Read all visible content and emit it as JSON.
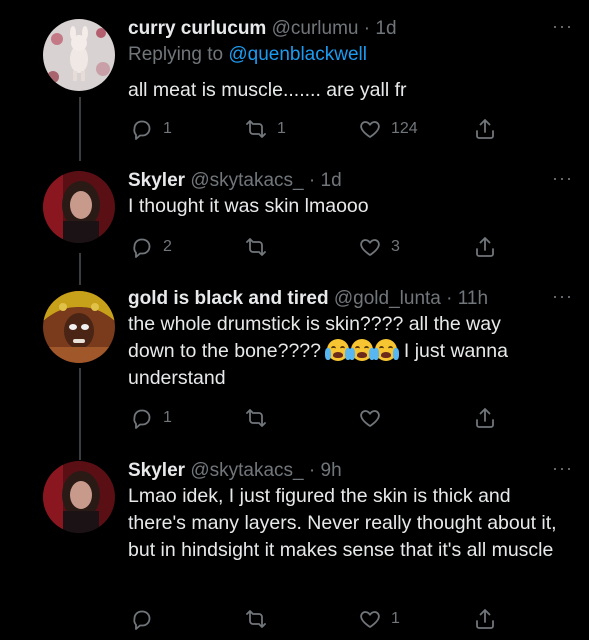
{
  "tweets": [
    {
      "name": "curry curlucum",
      "handle": "@curlumu",
      "dot": "·",
      "time": "1d",
      "reply_prefix": "Replying to",
      "reply_mention": "@quenblackwell",
      "text": "all meat is muscle....... are yall fr",
      "reply_count": "1",
      "retweet_count": "1",
      "like_count": "124"
    },
    {
      "name": "Skyler",
      "handle": "@skytakacs_",
      "dot": "·",
      "time": "1d",
      "text": "I thought it was skin lmaooo",
      "reply_count": "2",
      "retweet_count": "",
      "like_count": "3"
    },
    {
      "name": "gold is black and tired",
      "handle": "@gold_lunta",
      "dot": "·",
      "time": "11h",
      "text_a": "the whole drumstick is skin???? all the way",
      "text_b1": "down to the bone????",
      "text_b2": "I just wanna",
      "text_c": "understand",
      "emoji_icon": "loudly-crying-face-emoji",
      "reply_count": "1",
      "retweet_count": "",
      "like_count": ""
    },
    {
      "name": "Skyler",
      "handle": "@skytakacs_",
      "dot": "·",
      "time": "9h",
      "text": "Lmao idek, I just figured the skin is thick and there's many layers. Never really thought about it, but in hindsight it makes sense that it's all muscle",
      "reply_count": "",
      "retweet_count": "",
      "like_count": "1"
    }
  ],
  "more_label": "···",
  "colors": {
    "background": "#000000",
    "text": "#e7e9ea",
    "secondary": "#71767b",
    "accent": "#1d9bf0"
  }
}
